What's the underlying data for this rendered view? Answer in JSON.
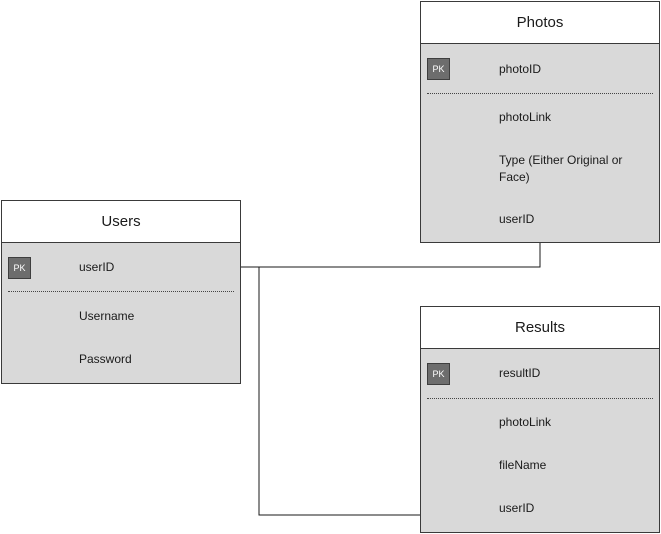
{
  "diagram_type": "entity-relationship",
  "entities": {
    "photos": {
      "title": "Photos",
      "pk_badge": "PK",
      "pk_field": "photoID",
      "fields": [
        "photoLink",
        "Type (Either Original or Face)",
        "userID"
      ]
    },
    "users": {
      "title": "Users",
      "pk_badge": "PK",
      "pk_field": "userID",
      "fields": [
        "Username",
        "Password"
      ]
    },
    "results": {
      "title": "Results",
      "pk_badge": "PK",
      "pk_field": "resultID",
      "fields": [
        "photoLink",
        "fileName",
        "userID"
      ]
    }
  },
  "relationships": [
    {
      "from": "Users.userID",
      "to": "Photos.userID"
    },
    {
      "from": "Users.userID",
      "to": "Results.userID"
    }
  ],
  "colors": {
    "entity_fill": "#d9d9d9",
    "header_fill": "#ffffff",
    "border": "#3a3a3a",
    "pk_badge": "#6d6d6d",
    "connector": "#1a1a1a"
  }
}
